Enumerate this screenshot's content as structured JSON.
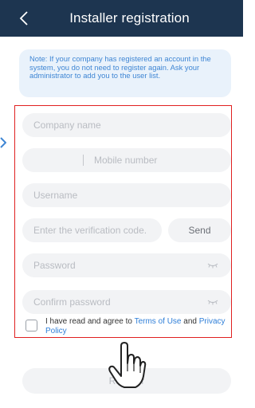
{
  "header": {
    "title": "Installer registration",
    "back_icon": "chevron-left-icon"
  },
  "note": {
    "text": "Note: If your company has registered an account in the system, you do not need to register again. Ask your administrator to add you to the user list."
  },
  "form": {
    "company_placeholder": "Company name",
    "mobile_placeholder": "Mobile number",
    "username_placeholder": "Username",
    "verification_placeholder": "Enter the verification code.",
    "send_label": "Send",
    "password_placeholder": "Password",
    "confirm_placeholder": "Confirm password",
    "password_icon": "eye-closed-icon"
  },
  "agreement": {
    "prefix": "I have read and agree to ",
    "terms_link": "Terms of Use",
    "and": " and ",
    "privacy_link": "Privacy Policy",
    "checked": false
  },
  "register": {
    "label": "Register"
  },
  "colors": {
    "header_bg": "#1d3550",
    "note_bg": "#e9f2fb",
    "note_text": "#3f86d4",
    "link": "#2f7fd8",
    "highlight_border": "#e02020",
    "field_bg": "#f2f3f5"
  }
}
